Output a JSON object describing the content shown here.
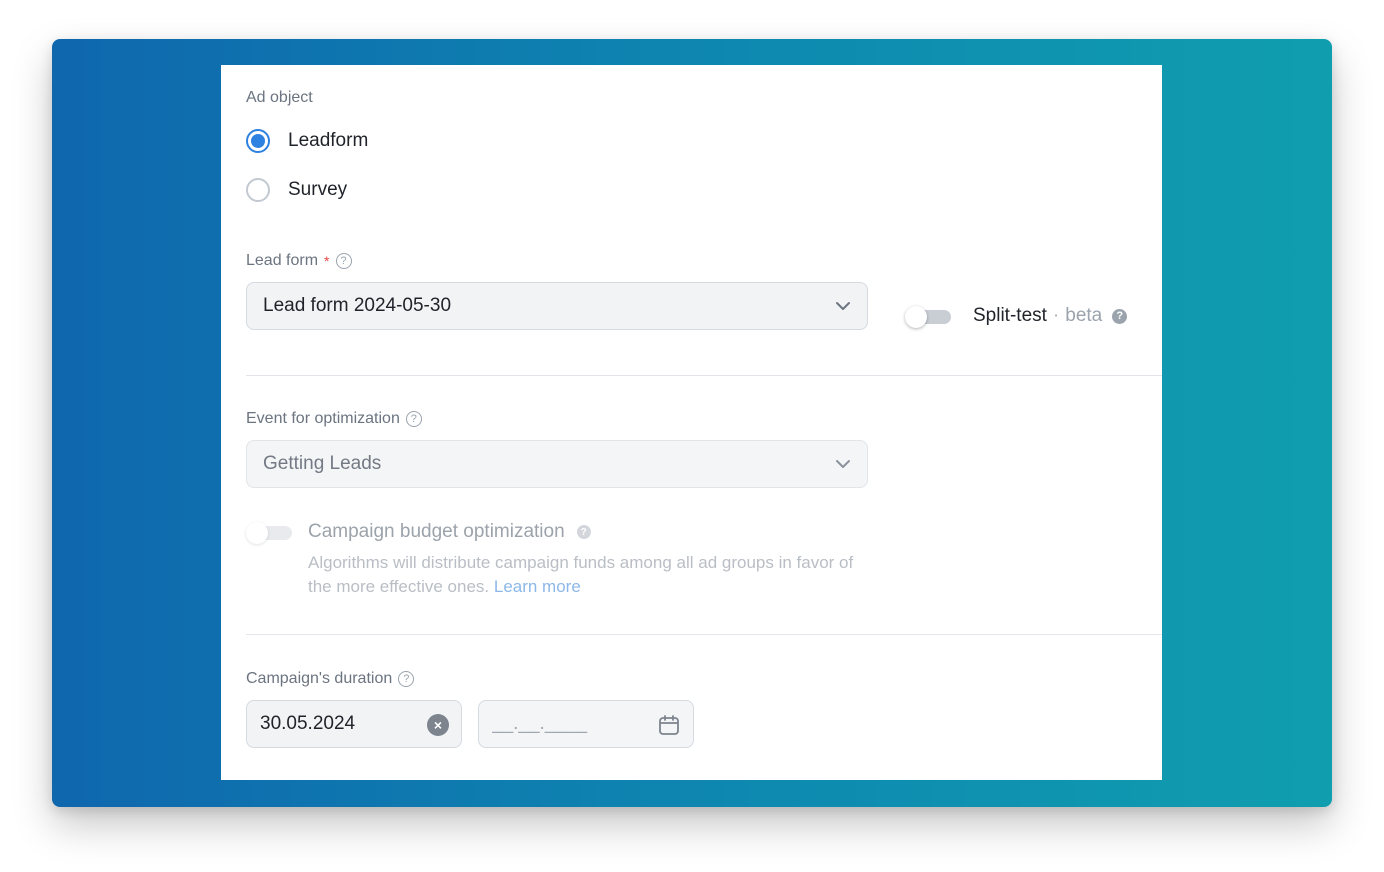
{
  "ad_object": {
    "label": "Ad object",
    "options": [
      {
        "label": "Leadform",
        "checked": true
      },
      {
        "label": "Survey",
        "checked": false
      }
    ]
  },
  "lead_form": {
    "label": "Lead form",
    "required_mark": "*",
    "selected": "Lead form 2024-05-30"
  },
  "split_test": {
    "label": "Split-test",
    "separator": "·",
    "badge": "beta",
    "enabled": false
  },
  "event_optimization": {
    "label": "Event for optimization",
    "selected": "Getting Leads"
  },
  "campaign_budget_optimization": {
    "title": "Campaign budget optimization",
    "description": "Algorithms will distribute campaign funds among all ad groups in favor of the more effective ones.",
    "learn_more": "Learn more",
    "enabled": false
  },
  "campaign_duration": {
    "label": "Campaign's duration",
    "start_value": "30.05.2024",
    "end_placeholder": "__.__.____"
  },
  "colors": {
    "accent": "#2d81e0",
    "backdrop_start": "#0f67ae",
    "backdrop_end": "#109eaf"
  }
}
